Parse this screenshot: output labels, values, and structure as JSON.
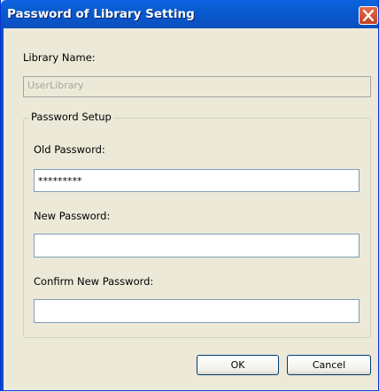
{
  "window": {
    "title": "Password of Library Setting"
  },
  "library": {
    "label": "Library Name:",
    "value": "UserLibrary"
  },
  "password_setup": {
    "group_title": "Password Setup",
    "old_label": "Old Password:",
    "old_value": "*********",
    "new_label": "New Password:",
    "new_value": "",
    "confirm_label": "Confirm New Password:",
    "confirm_value": ""
  },
  "buttons": {
    "ok": "OK",
    "cancel": "Cancel"
  },
  "colors": {
    "titlebar": "#0a58d0",
    "close_button": "#d4532f",
    "dialog_background": "#ece9d8"
  },
  "icons": {
    "close": "close-icon"
  }
}
